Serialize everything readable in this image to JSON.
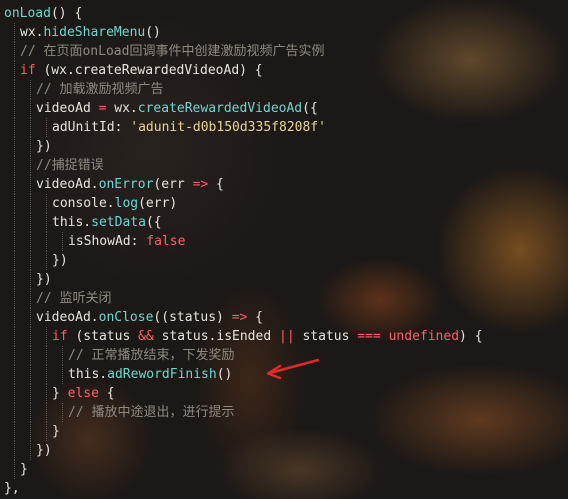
{
  "colors": {
    "keyword": "#ff5f6d",
    "function": "#6fd6d0",
    "string": "#e6d88a",
    "comment": "#8f8a80",
    "text": "#e8e4dc",
    "annotation_arrow": "#e02a2a"
  },
  "lines": [
    {
      "id": "l0",
      "indent": 0,
      "tokens": [
        {
          "t": "onLoad",
          "c": "fn"
        },
        {
          "t": "() {",
          "c": "prop"
        }
      ]
    },
    {
      "id": "l1",
      "indent": 1,
      "tokens": [
        {
          "t": "wx.",
          "c": "prop"
        },
        {
          "t": "hideShareMenu",
          "c": "fn"
        },
        {
          "t": "()",
          "c": "prop"
        }
      ]
    },
    {
      "id": "l2",
      "indent": 1,
      "tokens": [
        {
          "t": "// 在页面onLoad回调事件中创建激励视频广告实例",
          "c": "cmt"
        }
      ]
    },
    {
      "id": "l3",
      "indent": 1,
      "tokens": [
        {
          "t": "if",
          "c": "kw"
        },
        {
          "t": " (wx.createRewardedVideoAd) {",
          "c": "prop"
        }
      ]
    },
    {
      "id": "l4",
      "indent": 2,
      "tokens": [
        {
          "t": "// 加载激励视频广告",
          "c": "cmt"
        }
      ]
    },
    {
      "id": "l5",
      "indent": 2,
      "tokens": [
        {
          "t": "videoAd ",
          "c": "prop"
        },
        {
          "t": "=",
          "c": "kw"
        },
        {
          "t": " wx.",
          "c": "prop"
        },
        {
          "t": "createRewardedVideoAd",
          "c": "fn"
        },
        {
          "t": "({",
          "c": "prop"
        }
      ]
    },
    {
      "id": "l6",
      "indent": 3,
      "tokens": [
        {
          "t": "adUnitId: ",
          "c": "prop"
        },
        {
          "t": "'adunit-d0b150d335f8208f'",
          "c": "str"
        }
      ]
    },
    {
      "id": "l7",
      "indent": 2,
      "tokens": [
        {
          "t": "})",
          "c": "prop"
        }
      ]
    },
    {
      "id": "l8",
      "indent": 2,
      "tokens": [
        {
          "t": "//捕捉错误",
          "c": "cmt"
        }
      ]
    },
    {
      "id": "l9",
      "indent": 2,
      "tokens": [
        {
          "t": "videoAd.",
          "c": "prop"
        },
        {
          "t": "onError",
          "c": "fn"
        },
        {
          "t": "(err ",
          "c": "prop"
        },
        {
          "t": "=>",
          "c": "kw"
        },
        {
          "t": " {",
          "c": "prop"
        }
      ]
    },
    {
      "id": "l10",
      "indent": 3,
      "tokens": [
        {
          "t": "console.",
          "c": "prop"
        },
        {
          "t": "log",
          "c": "fn"
        },
        {
          "t": "(err)",
          "c": "prop"
        }
      ]
    },
    {
      "id": "l11",
      "indent": 3,
      "tokens": [
        {
          "t": "this.",
          "c": "prop"
        },
        {
          "t": "setData",
          "c": "fn"
        },
        {
          "t": "({",
          "c": "prop"
        }
      ]
    },
    {
      "id": "l12",
      "indent": 4,
      "tokens": [
        {
          "t": "isShowAd: ",
          "c": "prop"
        },
        {
          "t": "false",
          "c": "kw"
        }
      ]
    },
    {
      "id": "l13",
      "indent": 3,
      "tokens": [
        {
          "t": "})",
          "c": "prop"
        }
      ]
    },
    {
      "id": "l14",
      "indent": 2,
      "tokens": [
        {
          "t": "})",
          "c": "prop"
        }
      ]
    },
    {
      "id": "l15",
      "indent": 2,
      "tokens": [
        {
          "t": "// 监听关闭",
          "c": "cmt"
        }
      ]
    },
    {
      "id": "l16",
      "indent": 2,
      "tokens": [
        {
          "t": "videoAd.",
          "c": "prop"
        },
        {
          "t": "onClose",
          "c": "fn"
        },
        {
          "t": "((status) ",
          "c": "prop"
        },
        {
          "t": "=>",
          "c": "kw"
        },
        {
          "t": " {",
          "c": "prop"
        }
      ]
    },
    {
      "id": "l17",
      "indent": 3,
      "tokens": [
        {
          "t": "if",
          "c": "kw"
        },
        {
          "t": " (status ",
          "c": "prop"
        },
        {
          "t": "&&",
          "c": "kw"
        },
        {
          "t": " status.isEnded ",
          "c": "prop"
        },
        {
          "t": "||",
          "c": "kw"
        },
        {
          "t": " status ",
          "c": "prop"
        },
        {
          "t": "===",
          "c": "kw"
        },
        {
          "t": " ",
          "c": "prop"
        },
        {
          "t": "undefined",
          "c": "kw"
        },
        {
          "t": ") {",
          "c": "prop"
        }
      ]
    },
    {
      "id": "l18",
      "indent": 4,
      "tokens": [
        {
          "t": "// 正常播放结束，下发奖励",
          "c": "cmt"
        }
      ]
    },
    {
      "id": "l19",
      "indent": 4,
      "tokens": [
        {
          "t": "this.",
          "c": "prop"
        },
        {
          "t": "adRewordFinish",
          "c": "fn"
        },
        {
          "t": "()",
          "c": "prop"
        }
      ]
    },
    {
      "id": "l20",
      "indent": 3,
      "tokens": [
        {
          "t": "} ",
          "c": "prop"
        },
        {
          "t": "else",
          "c": "kw"
        },
        {
          "t": " {",
          "c": "prop"
        }
      ]
    },
    {
      "id": "l21",
      "indent": 4,
      "tokens": [
        {
          "t": "// 播放中途退出，进行提示",
          "c": "cmt"
        }
      ]
    },
    {
      "id": "l22",
      "indent": 3,
      "tokens": [
        {
          "t": "}",
          "c": "prop"
        }
      ]
    },
    {
      "id": "l23",
      "indent": 2,
      "tokens": [
        {
          "t": "})",
          "c": "prop"
        }
      ]
    },
    {
      "id": "l24",
      "indent": 1,
      "tokens": [
        {
          "t": "}",
          "c": "prop"
        }
      ]
    },
    {
      "id": "l25",
      "indent": 0,
      "tokens": [
        {
          "t": "},",
          "c": "prop"
        }
      ]
    }
  ]
}
